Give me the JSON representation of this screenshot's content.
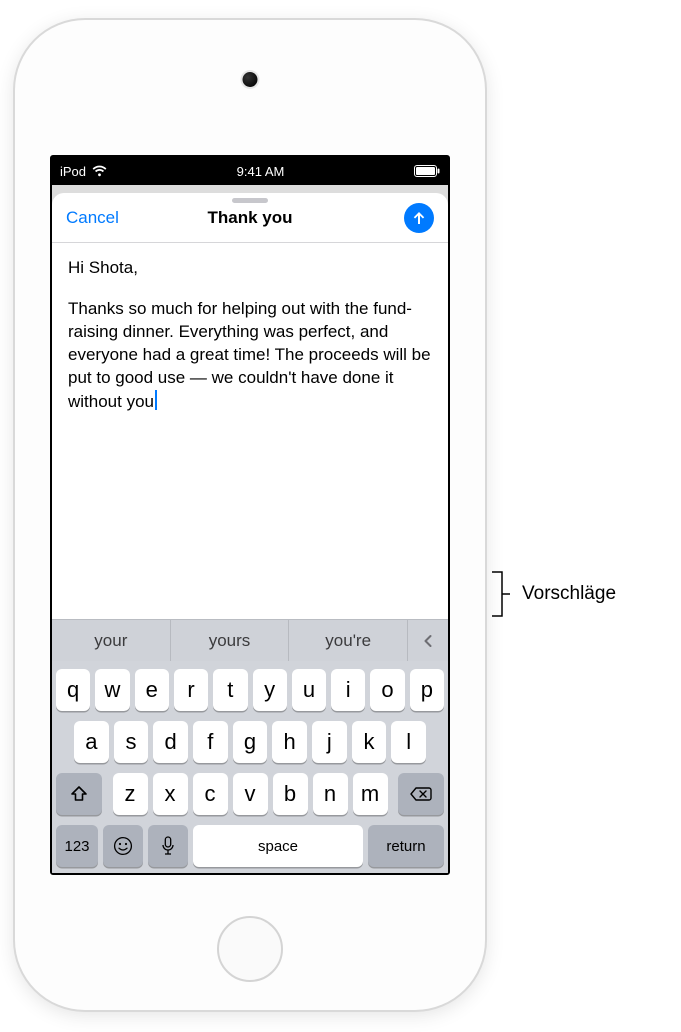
{
  "status": {
    "carrier": "iPod",
    "time": "9:41 AM"
  },
  "compose": {
    "cancel": "Cancel",
    "title": "Thank you",
    "body_line1": "Hi Shota,",
    "body_para": "Thanks so much for helping out with the fund-raising dinner. Everything was perfect, and everyone had a great time! The proceeds will be put to good use — we couldn't have done it without you"
  },
  "suggestions": [
    "your",
    "yours",
    "you're"
  ],
  "keyboard": {
    "row1": [
      "q",
      "w",
      "e",
      "r",
      "t",
      "y",
      "u",
      "i",
      "o",
      "p"
    ],
    "row2": [
      "a",
      "s",
      "d",
      "f",
      "g",
      "h",
      "j",
      "k",
      "l"
    ],
    "row3": [
      "z",
      "x",
      "c",
      "v",
      "b",
      "n",
      "m"
    ],
    "numeric_label": "123",
    "space_label": "space",
    "return_label": "return"
  },
  "callout": {
    "label": "Vorschläge"
  }
}
